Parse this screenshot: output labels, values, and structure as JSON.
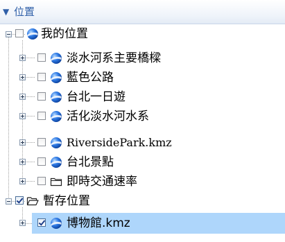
{
  "panel": {
    "title": "位置",
    "collapse_icon": "triangle-down-icon"
  },
  "tree": {
    "my_places": {
      "label": "我的位置",
      "checked": false,
      "icon": "globe-icon",
      "children": [
        {
          "label": "淡水河系主要橋樑",
          "icon": "globe-icon",
          "checked": false
        },
        {
          "label": "藍色公路",
          "icon": "globe-icon",
          "checked": false
        },
        {
          "label": "台北一日遊",
          "icon": "globe-icon",
          "checked": false
        },
        {
          "label": "活化淡水河水系",
          "icon": "globe-icon",
          "checked": false
        },
        {
          "label": "RiversidePark.kmz",
          "icon": "globe-icon",
          "checked": false
        },
        {
          "label": "台北景點",
          "icon": "globe-icon",
          "checked": false
        },
        {
          "label": "即時交通速率",
          "icon": "folder-icon",
          "checked": false
        }
      ]
    },
    "temp_places": {
      "label": "暫存位置",
      "checked": true,
      "icon": "open-folder-icon",
      "children": [
        {
          "label": "博物館.kmz",
          "icon": "globe-icon",
          "checked": true,
          "selected": true
        }
      ]
    }
  },
  "colors": {
    "header_text": "#2f5fa8",
    "selection": "#aed6fb"
  }
}
